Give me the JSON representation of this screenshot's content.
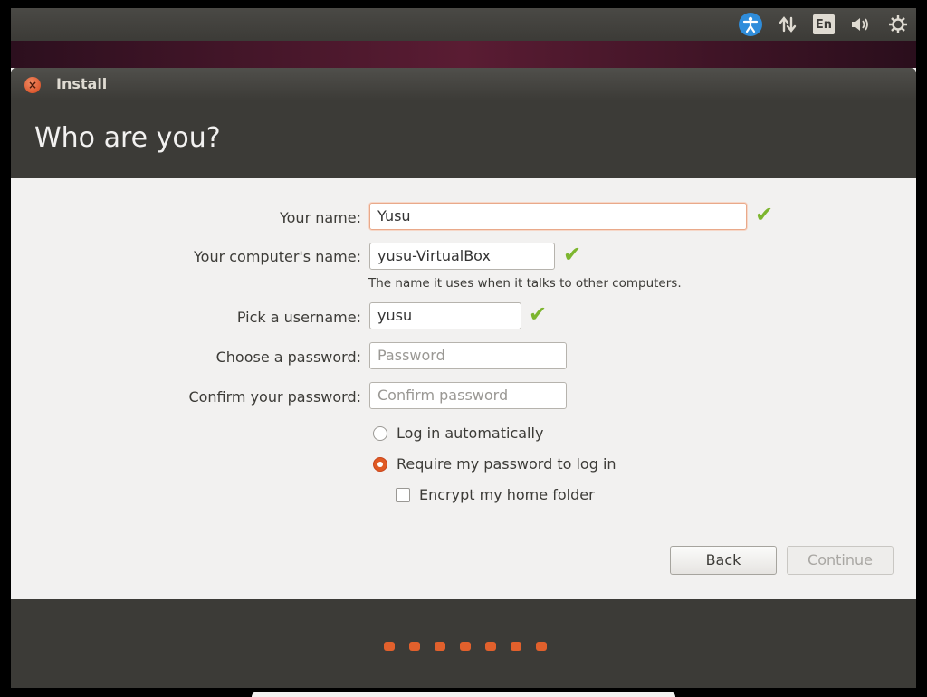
{
  "panel": {
    "icons": [
      "accessibility-icon",
      "network-icon",
      "keyboard-language-icon",
      "volume-icon",
      "power-settings-icon"
    ],
    "language": "En"
  },
  "window": {
    "title": "Install",
    "close_icon": "close-icon"
  },
  "header": {
    "title": "Who are you?"
  },
  "form": {
    "name_label": "Your name:",
    "name_value": "Yusu",
    "computer_label": "Your computer's name:",
    "computer_value": "yusu-VirtualBox",
    "computer_hint": "The name it uses when it talks to other computers.",
    "username_label": "Pick a username:",
    "username_value": "yusu",
    "password_label": "Choose a password:",
    "password_placeholder": "Password",
    "confirm_label": "Confirm your password:",
    "confirm_placeholder": "Confirm password",
    "login_auto": "Log in automatically",
    "login_require": "Require my password to log in",
    "encrypt": "Encrypt my home folder",
    "selected_login": "require",
    "encrypt_checked": false
  },
  "buttons": {
    "back": "Back",
    "continue": "Continue",
    "continue_enabled": false
  },
  "progress": {
    "steps": 7
  },
  "colors": {
    "accent": "#e05a24",
    "check": "#7db62f",
    "header": "#3c3b37",
    "background": "#f2f1f0"
  }
}
